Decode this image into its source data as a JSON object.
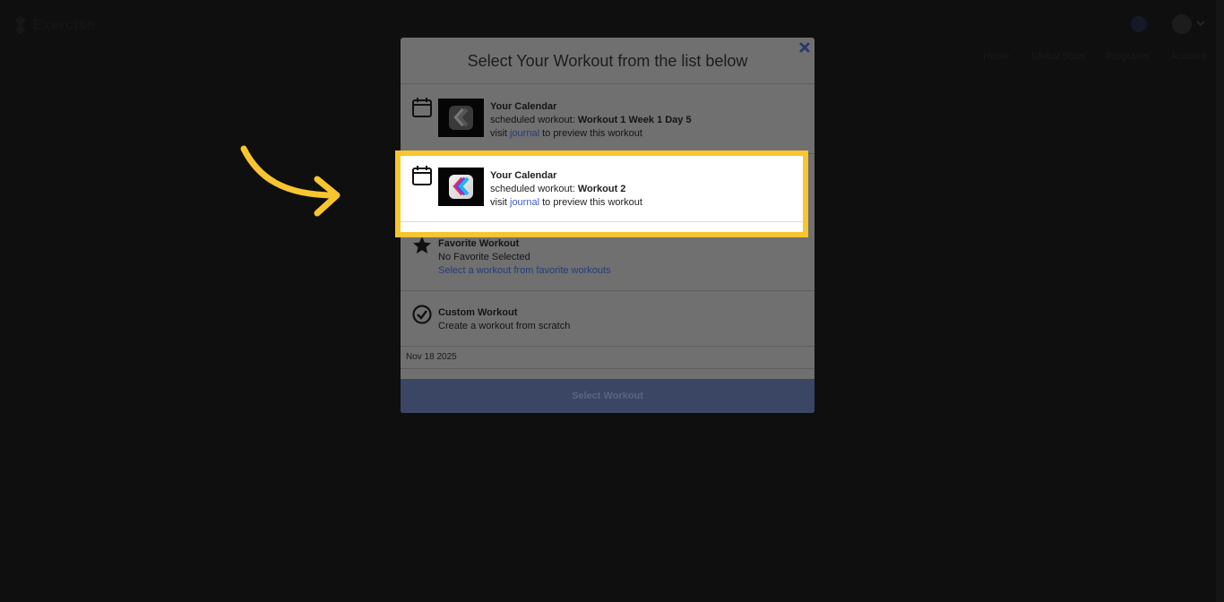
{
  "header": {
    "app_name": "Exercise",
    "nav_links": [
      "Home",
      "Global Stats",
      "Programs",
      "Account"
    ]
  },
  "modal": {
    "title": "Select Your Workout from the list below",
    "options": [
      {
        "icon": "calendar-icon",
        "title": "Your Calendar",
        "scheduled_prefix": "scheduled workout: ",
        "workout_name": "Workout 1 Week 1 Day 5",
        "visit_prefix": "visit ",
        "link_text": "journal",
        "visit_suffix": " to preview this workout"
      },
      {
        "icon": "calendar-icon",
        "title": "Your Calendar",
        "scheduled_prefix": "scheduled workout: ",
        "workout_name": "Workout 2",
        "visit_prefix": "visit ",
        "link_text": "journal",
        "visit_suffix": " to preview this workout",
        "highlighted": true
      },
      {
        "icon": "star-icon",
        "title": "Favorite Workout",
        "line1": "No Favorite Selected",
        "link_text": "Select a workout from favorite workouts"
      },
      {
        "icon": "check-circle-icon",
        "title": "Custom Workout",
        "line1": "Create a workout from scratch"
      }
    ],
    "date": "Nov 18 2025",
    "select_button": "Select Workout"
  },
  "colors": {
    "highlight": "#f7c52f",
    "arrow": "#f7c52f",
    "link": "#3b5bd0"
  }
}
